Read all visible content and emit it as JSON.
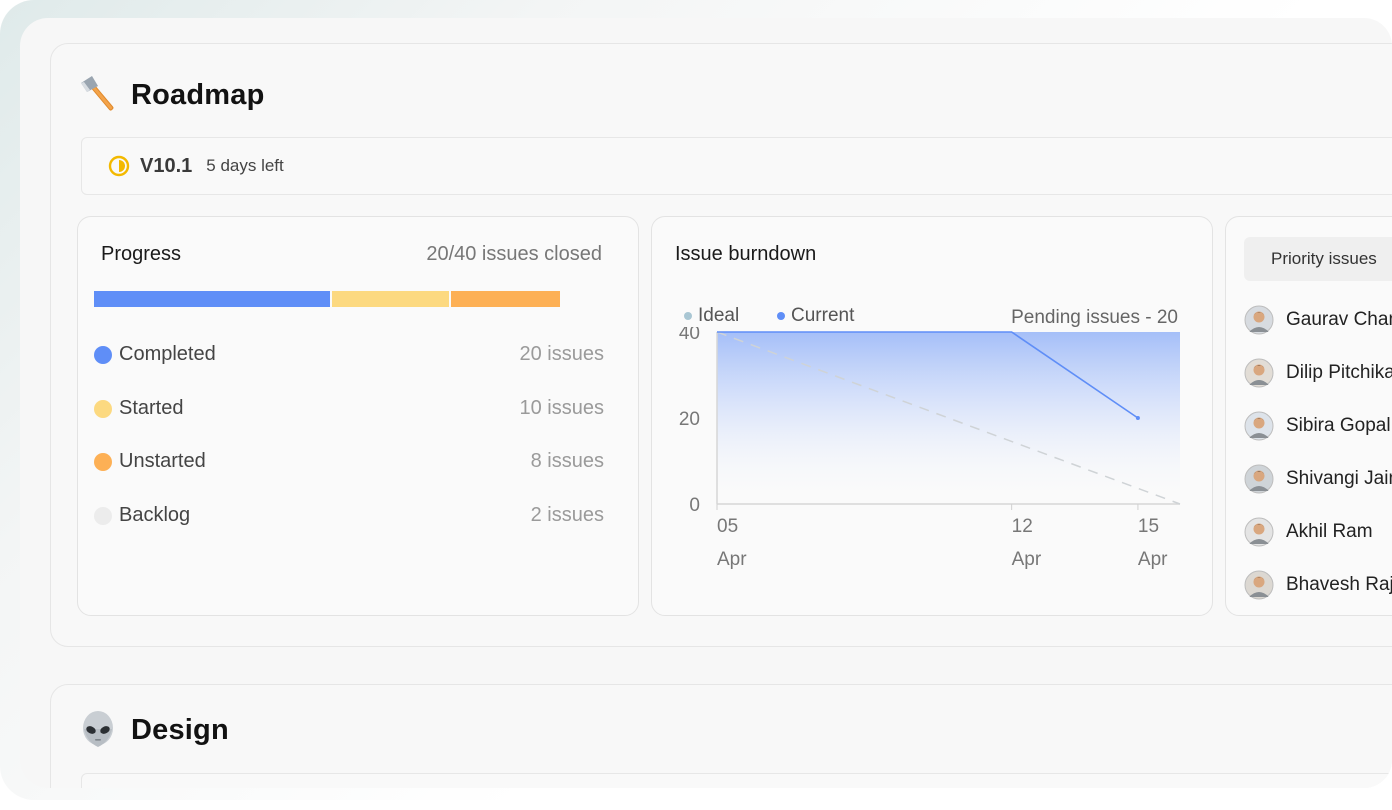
{
  "roadmap": {
    "title": "Roadmap",
    "icon": "axe-icon",
    "cycle": {
      "version": "V10.1",
      "days_left": "5 days left",
      "icon": "half-circle-progress-icon"
    },
    "progress": {
      "heading": "Progress",
      "summary": "20/40 issues closed",
      "segments": [
        {
          "name": "Completed",
          "color": "#5f8ef7"
        },
        {
          "name": "Started",
          "color": "#fcd980"
        },
        {
          "name": "Unstarted",
          "color": "#fdb055"
        }
      ],
      "legend": [
        {
          "label": "Completed",
          "count": "20 issues",
          "color": "#5f8ef7"
        },
        {
          "label": "Started",
          "count": "10 issues",
          "color": "#fcd980"
        },
        {
          "label": "Unstarted",
          "count": "8 issues",
          "color": "#fdb055"
        },
        {
          "label": "Backlog",
          "count": "2 issues",
          "color": "#ececec"
        }
      ]
    },
    "burndown": {
      "heading": "Issue burndown",
      "legend_ideal": "Ideal",
      "legend_current": "Current",
      "pending": "Pending issues - 20",
      "colors": {
        "ideal": "#a9c6d3",
        "current": "#5f8ef7"
      }
    },
    "priority": {
      "tab_label": "Priority issues",
      "assignees": [
        {
          "name": "Gaurav Chandra"
        },
        {
          "name": "Dilip Pitchika"
        },
        {
          "name": "Sibira Gopal"
        },
        {
          "name": "Shivangi Jain"
        },
        {
          "name": "Akhil Ram"
        },
        {
          "name": "Bhavesh Raja"
        }
      ]
    }
  },
  "design": {
    "title": "Design",
    "icon": "alien-icon"
  },
  "chart_data": {
    "type": "line",
    "title": "Issue burndown",
    "y_ticks": [
      "40",
      "20",
      "0"
    ],
    "x_ticks": [
      {
        "day": "05",
        "month": "Apr"
      },
      {
        "day": "12",
        "month": "Apr"
      },
      {
        "day": "15",
        "month": "Apr"
      }
    ],
    "ylim": [
      0,
      40
    ],
    "series": [
      {
        "name": "Ideal",
        "x": [
          5,
          16
        ],
        "y": [
          40,
          0
        ]
      },
      {
        "name": "Current",
        "x": [
          5,
          12,
          15
        ],
        "y": [
          40,
          40,
          20
        ]
      }
    ]
  }
}
